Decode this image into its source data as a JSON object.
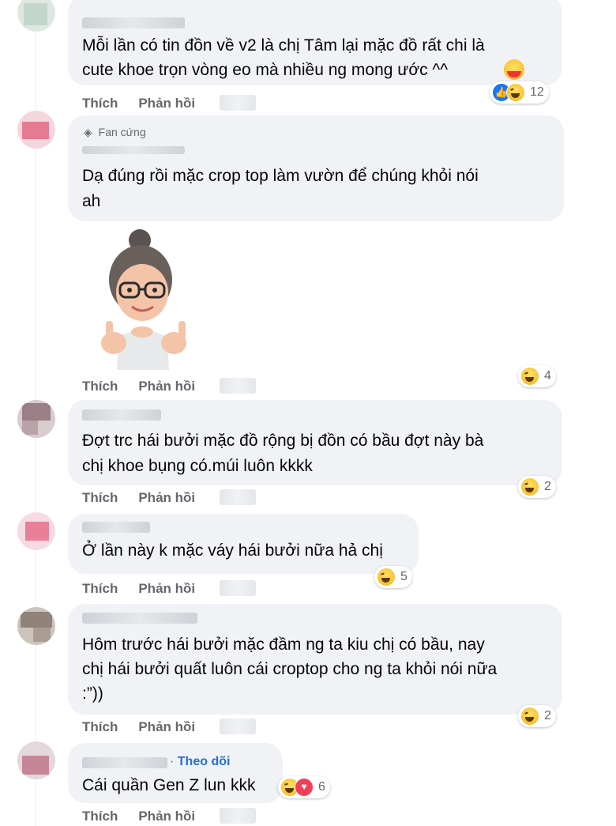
{
  "comments": [
    {
      "text_lines": [
        "Mỗi lần có tin đồn về v2 là chị Tâm lại mặc đồ rất chi là",
        "cute khoe trọn vòng eo mà nhiều ng mong ước ^^"
      ],
      "inline_emoji": "care-emoji",
      "reactions": [
        "like",
        "haha"
      ],
      "reaction_count": "12",
      "actions": {
        "like": "Thích",
        "reply": "Phản hồi"
      }
    },
    {
      "badge": "Fan cứng",
      "badge_icon": "diamond-icon",
      "text_lines": [
        "Dạ đúng rồi mặc crop top làm vườn để chúng khỏi nói",
        "ah"
      ],
      "sticker": "memoji-thumbs-up-sticker",
      "reactions": [
        "haha"
      ],
      "reaction_count": "4",
      "actions": {
        "like": "Thích",
        "reply": "Phản hồi"
      }
    },
    {
      "text_lines": [
        "Đợt trc hái bưởi mặc đồ rộng bị đồn có bầu đợt này bà",
        "chị khoe bụng có.múi luôn kkkk"
      ],
      "reactions": [
        "haha"
      ],
      "reaction_count": "2",
      "actions": {
        "like": "Thích",
        "reply": "Phản hồi"
      }
    },
    {
      "text_lines": [
        "Ở lần này k mặc váy hái bưởi nữa hả chị"
      ],
      "reactions": [
        "haha"
      ],
      "reaction_count": "5",
      "actions": {
        "like": "Thích",
        "reply": "Phản hồi"
      }
    },
    {
      "text_lines": [
        "Hôm trước hái bưởi mặc đầm ng ta kiu chị có bầu, nay",
        "chị hái bưởi quất luôn cái croptop cho ng ta khỏi nói nữa",
        ":”))"
      ],
      "reactions": [
        "haha"
      ],
      "reaction_count": "2",
      "actions": {
        "like": "Thích",
        "reply": "Phản hồi"
      }
    },
    {
      "follow_label": "Theo dõi",
      "text_lines": [
        "Cái quần Gen Z lun kkk"
      ],
      "reactions": [
        "haha",
        "love"
      ],
      "reaction_count": "6",
      "actions": {
        "like": "Thích",
        "reply": "Phản hồi"
      }
    }
  ],
  "colors": {
    "bubble": "#f0f2f5",
    "action_text": "#65676b",
    "link": "#216fdb"
  }
}
